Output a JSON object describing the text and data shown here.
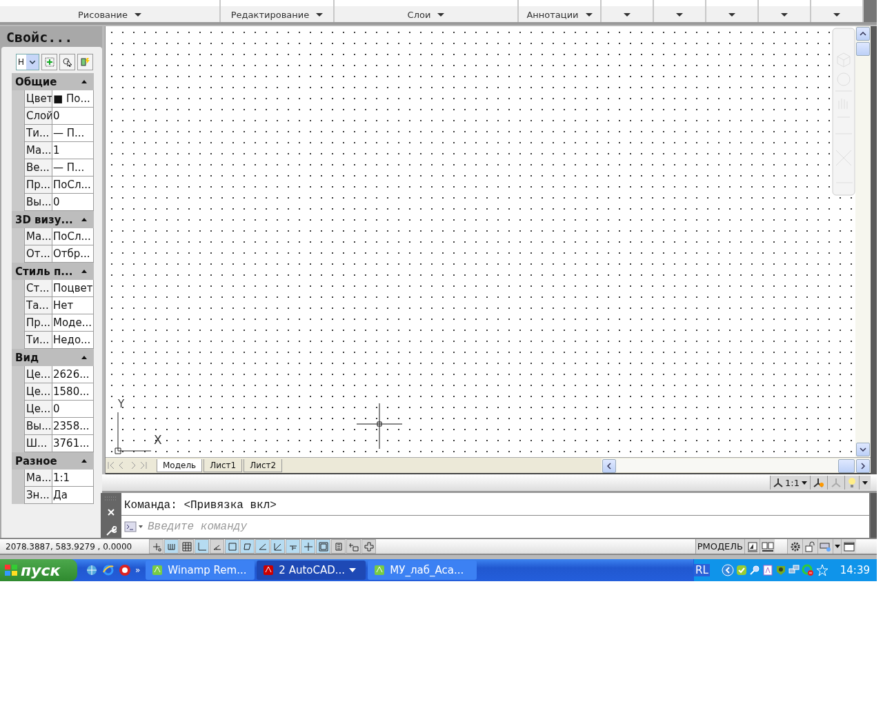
{
  "ribbon": {
    "panels": [
      {
        "label": "Рисование",
        "kind": "labeled"
      },
      {
        "label": "Редактирование",
        "kind": "labeled"
      },
      {
        "label": "Слои",
        "kind": "labeled"
      },
      {
        "label": "Аннотации",
        "kind": "labeled"
      },
      {
        "kind": "empty"
      },
      {
        "kind": "empty"
      },
      {
        "kind": "empty"
      },
      {
        "kind": "empty"
      },
      {
        "kind": "empty"
      }
    ]
  },
  "properties": {
    "title": "Свойс...",
    "selector_value": "Н",
    "sections": [
      {
        "title": "Общие",
        "expanded": true,
        "rows": [
          {
            "name": "Цвет",
            "value": "■ По..."
          },
          {
            "name": "Слой",
            "value": "0"
          },
          {
            "name": "Ти...",
            "value": "— П..."
          },
          {
            "name": "Ма...",
            "value": "1"
          },
          {
            "name": "Ве...",
            "value": "— П..."
          },
          {
            "name": "Пр...",
            "value": "ПоСл..."
          },
          {
            "name": "Вы...",
            "value": "0"
          }
        ]
      },
      {
        "title": "3D визу...",
        "expanded": true,
        "rows": [
          {
            "name": "Ма...",
            "value": "ПоСл..."
          },
          {
            "name": "От...",
            "value": "Отбр..."
          }
        ]
      },
      {
        "title": "Стиль п...",
        "expanded": true,
        "rows": [
          {
            "name": "Ст...",
            "value": "Поцвет"
          },
          {
            "name": "Та...",
            "value": "Нет"
          },
          {
            "name": "Пр...",
            "value": "Моде..."
          },
          {
            "name": "Ти...",
            "value": "Недо..."
          }
        ]
      },
      {
        "title": "Вид",
        "expanded": true,
        "rows": [
          {
            "name": "Це...",
            "value": "2626..."
          },
          {
            "name": "Це...",
            "value": "1580..."
          },
          {
            "name": "Це...",
            "value": "0"
          },
          {
            "name": "Вы...",
            "value": "2358..."
          },
          {
            "name": "Ш...",
            "value": "3761..."
          }
        ]
      },
      {
        "title": "Разное",
        "expanded": true,
        "rows": [
          {
            "name": "Ма...",
            "value": "1:1"
          },
          {
            "name": "Зн...",
            "value": "Да"
          }
        ]
      }
    ]
  },
  "canvas": {
    "ucs_x": "X",
    "ucs_y": "Y"
  },
  "layout_tabs": [
    {
      "label": "Модель",
      "selected": true
    },
    {
      "label": "Лист1",
      "selected": false
    },
    {
      "label": "Лист2",
      "selected": false
    }
  ],
  "annotation_scale": "1:1",
  "command": {
    "history": "Команда:  <Привязка вкл>",
    "placeholder": "Введите команду"
  },
  "status_bar": {
    "coordinates": "2078.3887, 583.9279 , 0.0000",
    "toggles": [
      {
        "on": false
      },
      {
        "on": true
      },
      {
        "on": false
      },
      {
        "on": true
      },
      {
        "on": false
      },
      {
        "on": true
      },
      {
        "on": true
      },
      {
        "on": true
      },
      {
        "on": true
      },
      {
        "on": true
      },
      {
        "on": true
      },
      {
        "on": true
      },
      {
        "on": false
      },
      {
        "on": false
      },
      {
        "on": false
      }
    ],
    "space": "РМОДЕЛЬ"
  },
  "taskbar": {
    "start": "пуск",
    "more": "»",
    "tasks": [
      {
        "label": "Winamp Rem...",
        "selected": false
      },
      {
        "label": "2 AutoCAD...",
        "selected": true
      },
      {
        "label": "МУ_лаб_Aca...",
        "selected": false
      }
    ],
    "tray_lang": "RL",
    "clock": "14:39"
  }
}
